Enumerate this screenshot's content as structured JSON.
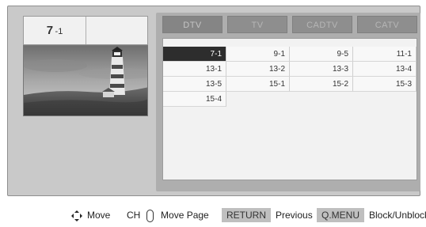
{
  "channel_header": {
    "number": "7",
    "sub": "-1",
    "name": ""
  },
  "tabs": [
    {
      "label": "DTV"
    },
    {
      "label": "TV"
    },
    {
      "label": "CADTV"
    },
    {
      "label": "CATV"
    }
  ],
  "active_tab": "DTV",
  "channels": [
    "7-1",
    "9-1",
    "9-5",
    "11-1",
    "13-1",
    "13-2",
    "13-3",
    "13-4",
    "13-5",
    "15-1",
    "15-2",
    "15-3",
    "15-4"
  ],
  "selected_channel": "7-1",
  "help": {
    "move": "Move",
    "ch": "CH",
    "move_page": "Move Page",
    "return_key": "RETURN",
    "previous": "Previous",
    "qmenu_key": "Q.MENU",
    "block_unblock": "Block/Unblock"
  },
  "icons": {
    "arrows": "four-way-arrows-icon",
    "ch_rocker": "ch-rocker-icon"
  }
}
